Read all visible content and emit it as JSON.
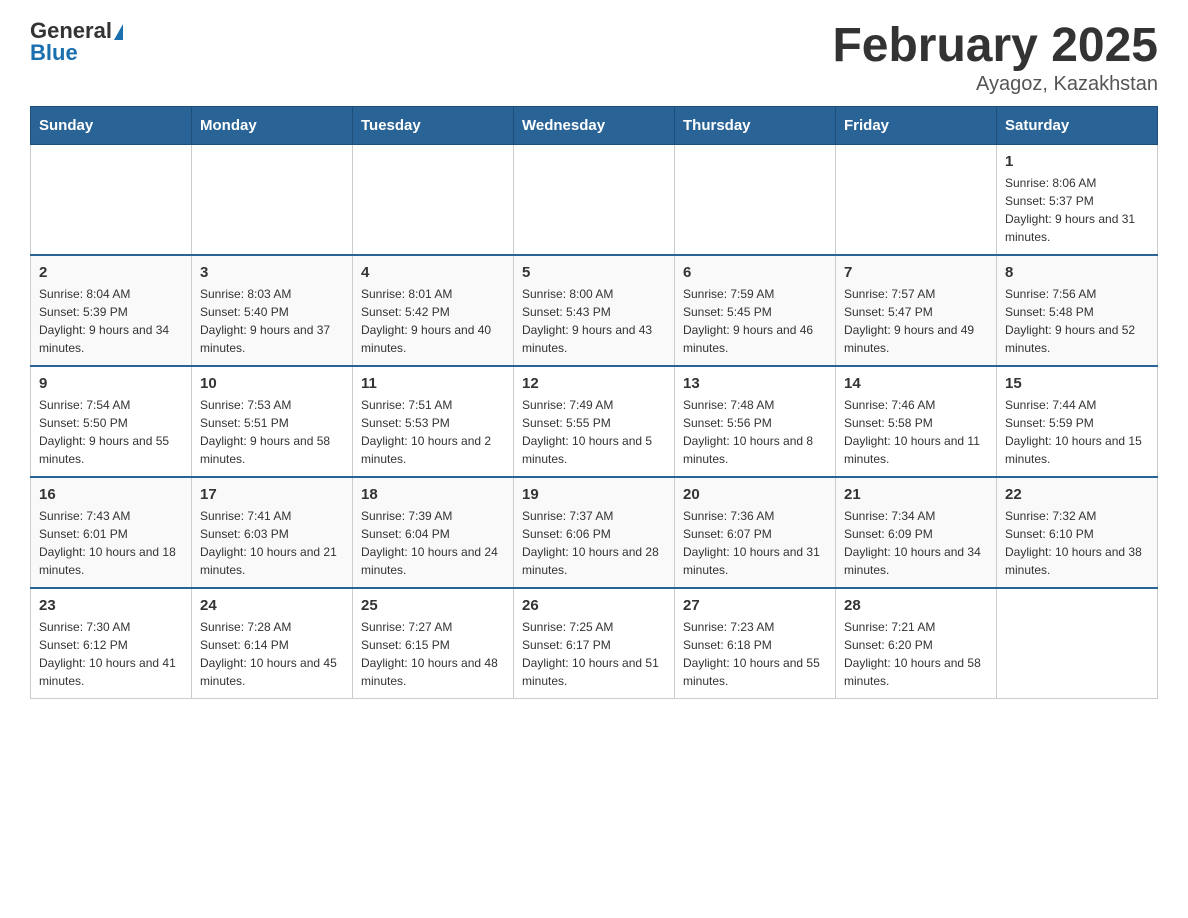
{
  "header": {
    "logo_general": "General",
    "logo_blue": "Blue",
    "month_title": "February 2025",
    "location": "Ayagoz, Kazakhstan"
  },
  "weekdays": [
    "Sunday",
    "Monday",
    "Tuesday",
    "Wednesday",
    "Thursday",
    "Friday",
    "Saturday"
  ],
  "weeks": [
    [
      {
        "day": "",
        "sunrise": "",
        "sunset": "",
        "daylight": ""
      },
      {
        "day": "",
        "sunrise": "",
        "sunset": "",
        "daylight": ""
      },
      {
        "day": "",
        "sunrise": "",
        "sunset": "",
        "daylight": ""
      },
      {
        "day": "",
        "sunrise": "",
        "sunset": "",
        "daylight": ""
      },
      {
        "day": "",
        "sunrise": "",
        "sunset": "",
        "daylight": ""
      },
      {
        "day": "",
        "sunrise": "",
        "sunset": "",
        "daylight": ""
      },
      {
        "day": "1",
        "sunrise": "Sunrise: 8:06 AM",
        "sunset": "Sunset: 5:37 PM",
        "daylight": "Daylight: 9 hours and 31 minutes."
      }
    ],
    [
      {
        "day": "2",
        "sunrise": "Sunrise: 8:04 AM",
        "sunset": "Sunset: 5:39 PM",
        "daylight": "Daylight: 9 hours and 34 minutes."
      },
      {
        "day": "3",
        "sunrise": "Sunrise: 8:03 AM",
        "sunset": "Sunset: 5:40 PM",
        "daylight": "Daylight: 9 hours and 37 minutes."
      },
      {
        "day": "4",
        "sunrise": "Sunrise: 8:01 AM",
        "sunset": "Sunset: 5:42 PM",
        "daylight": "Daylight: 9 hours and 40 minutes."
      },
      {
        "day": "5",
        "sunrise": "Sunrise: 8:00 AM",
        "sunset": "Sunset: 5:43 PM",
        "daylight": "Daylight: 9 hours and 43 minutes."
      },
      {
        "day": "6",
        "sunrise": "Sunrise: 7:59 AM",
        "sunset": "Sunset: 5:45 PM",
        "daylight": "Daylight: 9 hours and 46 minutes."
      },
      {
        "day": "7",
        "sunrise": "Sunrise: 7:57 AM",
        "sunset": "Sunset: 5:47 PM",
        "daylight": "Daylight: 9 hours and 49 minutes."
      },
      {
        "day": "8",
        "sunrise": "Sunrise: 7:56 AM",
        "sunset": "Sunset: 5:48 PM",
        "daylight": "Daylight: 9 hours and 52 minutes."
      }
    ],
    [
      {
        "day": "9",
        "sunrise": "Sunrise: 7:54 AM",
        "sunset": "Sunset: 5:50 PM",
        "daylight": "Daylight: 9 hours and 55 minutes."
      },
      {
        "day": "10",
        "sunrise": "Sunrise: 7:53 AM",
        "sunset": "Sunset: 5:51 PM",
        "daylight": "Daylight: 9 hours and 58 minutes."
      },
      {
        "day": "11",
        "sunrise": "Sunrise: 7:51 AM",
        "sunset": "Sunset: 5:53 PM",
        "daylight": "Daylight: 10 hours and 2 minutes."
      },
      {
        "day": "12",
        "sunrise": "Sunrise: 7:49 AM",
        "sunset": "Sunset: 5:55 PM",
        "daylight": "Daylight: 10 hours and 5 minutes."
      },
      {
        "day": "13",
        "sunrise": "Sunrise: 7:48 AM",
        "sunset": "Sunset: 5:56 PM",
        "daylight": "Daylight: 10 hours and 8 minutes."
      },
      {
        "day": "14",
        "sunrise": "Sunrise: 7:46 AM",
        "sunset": "Sunset: 5:58 PM",
        "daylight": "Daylight: 10 hours and 11 minutes."
      },
      {
        "day": "15",
        "sunrise": "Sunrise: 7:44 AM",
        "sunset": "Sunset: 5:59 PM",
        "daylight": "Daylight: 10 hours and 15 minutes."
      }
    ],
    [
      {
        "day": "16",
        "sunrise": "Sunrise: 7:43 AM",
        "sunset": "Sunset: 6:01 PM",
        "daylight": "Daylight: 10 hours and 18 minutes."
      },
      {
        "day": "17",
        "sunrise": "Sunrise: 7:41 AM",
        "sunset": "Sunset: 6:03 PM",
        "daylight": "Daylight: 10 hours and 21 minutes."
      },
      {
        "day": "18",
        "sunrise": "Sunrise: 7:39 AM",
        "sunset": "Sunset: 6:04 PM",
        "daylight": "Daylight: 10 hours and 24 minutes."
      },
      {
        "day": "19",
        "sunrise": "Sunrise: 7:37 AM",
        "sunset": "Sunset: 6:06 PM",
        "daylight": "Daylight: 10 hours and 28 minutes."
      },
      {
        "day": "20",
        "sunrise": "Sunrise: 7:36 AM",
        "sunset": "Sunset: 6:07 PM",
        "daylight": "Daylight: 10 hours and 31 minutes."
      },
      {
        "day": "21",
        "sunrise": "Sunrise: 7:34 AM",
        "sunset": "Sunset: 6:09 PM",
        "daylight": "Daylight: 10 hours and 34 minutes."
      },
      {
        "day": "22",
        "sunrise": "Sunrise: 7:32 AM",
        "sunset": "Sunset: 6:10 PM",
        "daylight": "Daylight: 10 hours and 38 minutes."
      }
    ],
    [
      {
        "day": "23",
        "sunrise": "Sunrise: 7:30 AM",
        "sunset": "Sunset: 6:12 PM",
        "daylight": "Daylight: 10 hours and 41 minutes."
      },
      {
        "day": "24",
        "sunrise": "Sunrise: 7:28 AM",
        "sunset": "Sunset: 6:14 PM",
        "daylight": "Daylight: 10 hours and 45 minutes."
      },
      {
        "day": "25",
        "sunrise": "Sunrise: 7:27 AM",
        "sunset": "Sunset: 6:15 PM",
        "daylight": "Daylight: 10 hours and 48 minutes."
      },
      {
        "day": "26",
        "sunrise": "Sunrise: 7:25 AM",
        "sunset": "Sunset: 6:17 PM",
        "daylight": "Daylight: 10 hours and 51 minutes."
      },
      {
        "day": "27",
        "sunrise": "Sunrise: 7:23 AM",
        "sunset": "Sunset: 6:18 PM",
        "daylight": "Daylight: 10 hours and 55 minutes."
      },
      {
        "day": "28",
        "sunrise": "Sunrise: 7:21 AM",
        "sunset": "Sunset: 6:20 PM",
        "daylight": "Daylight: 10 hours and 58 minutes."
      },
      {
        "day": "",
        "sunrise": "",
        "sunset": "",
        "daylight": ""
      }
    ]
  ]
}
